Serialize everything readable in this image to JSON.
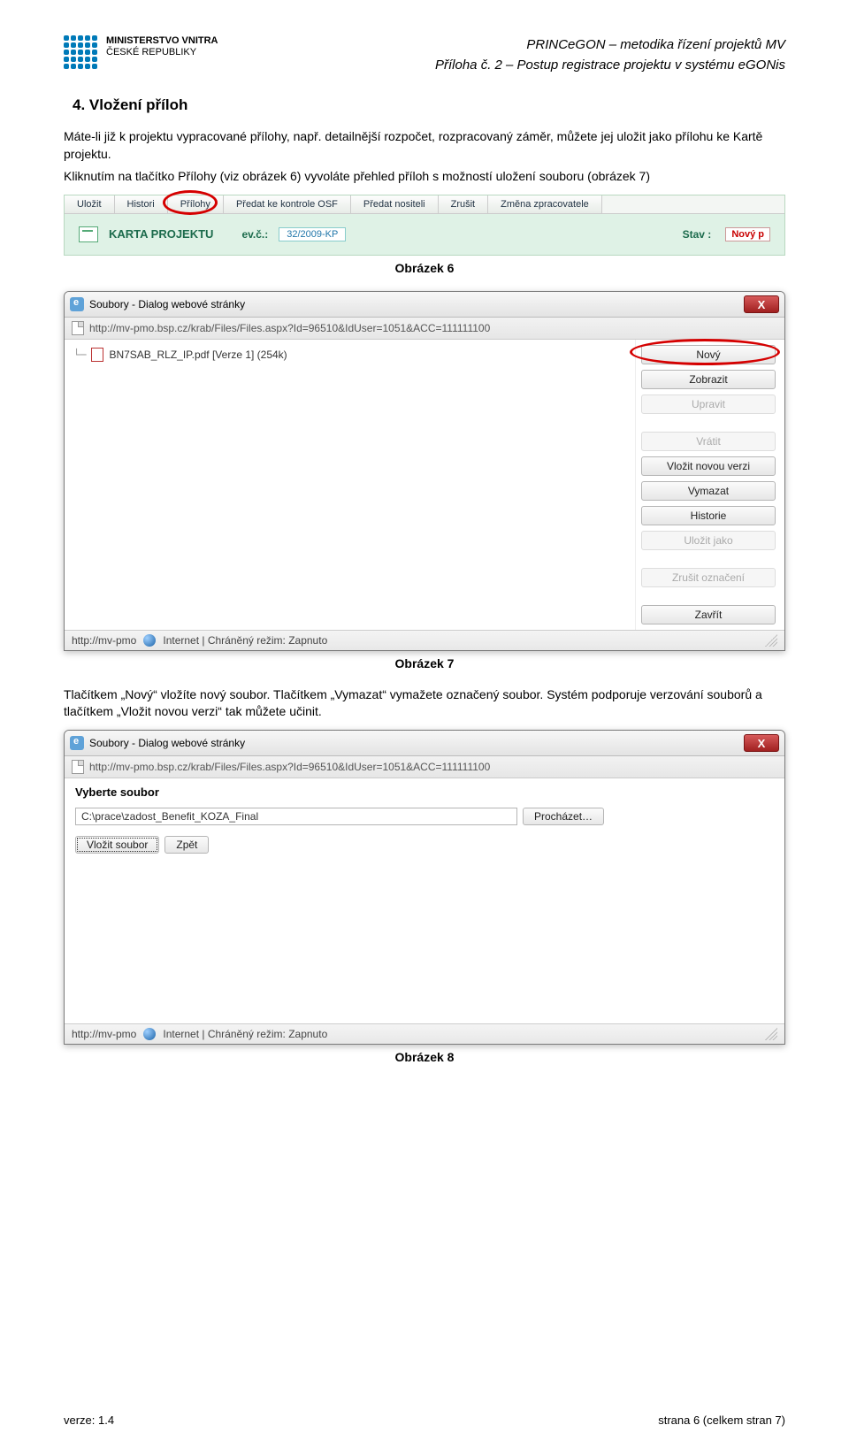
{
  "header": {
    "ministry_line1": "MINISTERSTVO VNITRA",
    "ministry_line2": "ČESKÉ REPUBLIKY",
    "doc_title": "PRINCeGON – metodika řízení projektů MV",
    "doc_subtitle": "Příloha č. 2 – Postup registrace projektu v systému eGONis"
  },
  "section": "4.  Vložení příloh",
  "para1": "Máte-li již k projektu vypracované přílohy, např. detailnější rozpočet, rozpracovaný záměr, můžete jej uložit jako přílohu ke Kartě projektu.",
  "para2": "Kliknutím na tlačítko Přílohy (viz obrázek 6) vyvoláte přehled příloh s možností uložení souboru (obrázek 7)",
  "fig6": {
    "toolbar": [
      "Uložit",
      "Histori",
      "Přílohy",
      "Předat ke kontrole OSF",
      "Předat nositeli",
      "Zrušit",
      "Změna zpracovatele"
    ],
    "card_title": "KARTA PROJEKTU",
    "evc_label": "ev.č.:",
    "evc_value": "32/2009-KP",
    "stav_label": "Stav :",
    "stav_value": "Nový p"
  },
  "caption6": "Obrázek 6",
  "fig7": {
    "title": "Soubory - Dialog webové stránky",
    "close": "X",
    "url": "http://mv-pmo.bsp.cz/krab/Files/Files.aspx?Id=96510&IdUser=1051&ACC=111111100",
    "file_entry": "BN7SAB_RLZ_IP.pdf [Verze 1] (254k)",
    "buttons": {
      "novy": "Nový",
      "zobrazit": "Zobrazit",
      "upravit": "Upravit",
      "vratit": "Vrátit",
      "vlozit_verzi": "Vložit novou verzi",
      "vymazat": "Vymazat",
      "historie": "Historie",
      "ulozit_jako": "Uložit jako",
      "zrusit_oznaceni": "Zrušit označení",
      "zavrit": "Zavřít"
    },
    "status_left": "http://mv-pmo",
    "status_right": "Internet | Chráněný režim: Zapnuto"
  },
  "caption7": "Obrázek 7",
  "para3": "Tlačítkem „Nový“ vložíte nový soubor. Tlačítkem „Vymazat“ vymažete označený soubor. Systém podporuje verzování souborů a tlačítkem „Vložit novou verzi“ tak můžete učinit.",
  "fig8": {
    "title": "Soubory - Dialog webové stránky",
    "close": "X",
    "url": "http://mv-pmo.bsp.cz/krab/Files/Files.aspx?Id=96510&IdUser=1051&ACC=111111100",
    "heading": "Vyberte soubor",
    "path": "C:\\prace\\zadost_Benefit_KOZA_Final",
    "browse": "Procházet…",
    "insert": "Vložit soubor",
    "back": "Zpět",
    "status_left": "http://mv-pmo",
    "status_right": "Internet | Chráněný režim: Zapnuto"
  },
  "caption8": "Obrázek 8",
  "footer": {
    "left": "verze: 1.4",
    "right": "strana 6 (celkem stran 7)"
  }
}
